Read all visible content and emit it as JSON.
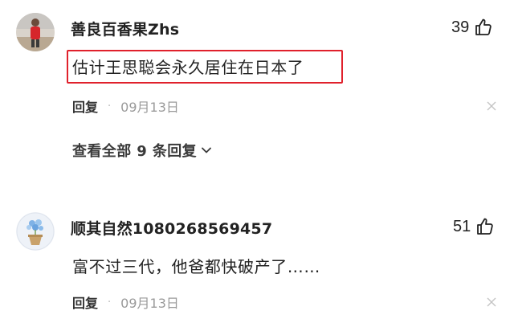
{
  "comments": [
    {
      "username": "善良百香果Zhs",
      "likes": "39",
      "content": "估计王思聪会永久居住在日本了",
      "reply_label": "回复",
      "separator": "·",
      "date": "09月13日",
      "view_replies": "查看全部 9 条回复",
      "avatar_icon": "person-in-red-avatar",
      "highlight_color": "#e0212c"
    },
    {
      "username": "顺其自然1080268569457",
      "likes": "51",
      "content": "富不过三代，他爸都快破产了……",
      "reply_label": "回复",
      "separator": "·",
      "date": "09月13日",
      "avatar_icon": "flower-pot-avatar"
    }
  ]
}
